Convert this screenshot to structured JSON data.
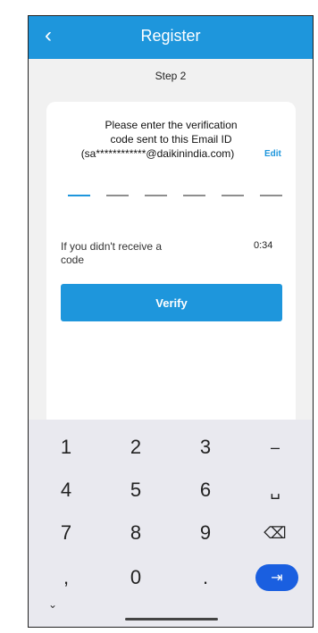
{
  "appbar": {
    "title": "Register",
    "back_icon": "chevron-left-icon"
  },
  "step_label": "Step 2",
  "verification": {
    "line1": "Please enter the verification",
    "line2": "code sent to this Email ID",
    "line3": "(sa************@daikinindia.com)",
    "edit_label": "Edit"
  },
  "otp": {
    "slots": 6,
    "active_index": 0
  },
  "resend": {
    "text": "If you didn't receive a code",
    "timer": "0:34"
  },
  "verify_button": "Verify",
  "keyboard": {
    "rows": [
      [
        "1",
        "2",
        "3",
        "–"
      ],
      [
        "4",
        "5",
        "6",
        "␣"
      ],
      [
        "7",
        "8",
        "9",
        "⌫"
      ],
      [
        ",",
        "0",
        "."
      ]
    ],
    "enter_icon": "enter-arrow-icon",
    "hide_icon": "chevron-down-icon"
  },
  "colors": {
    "primary": "#1e96dc",
    "enter": "#1a5fe0"
  }
}
